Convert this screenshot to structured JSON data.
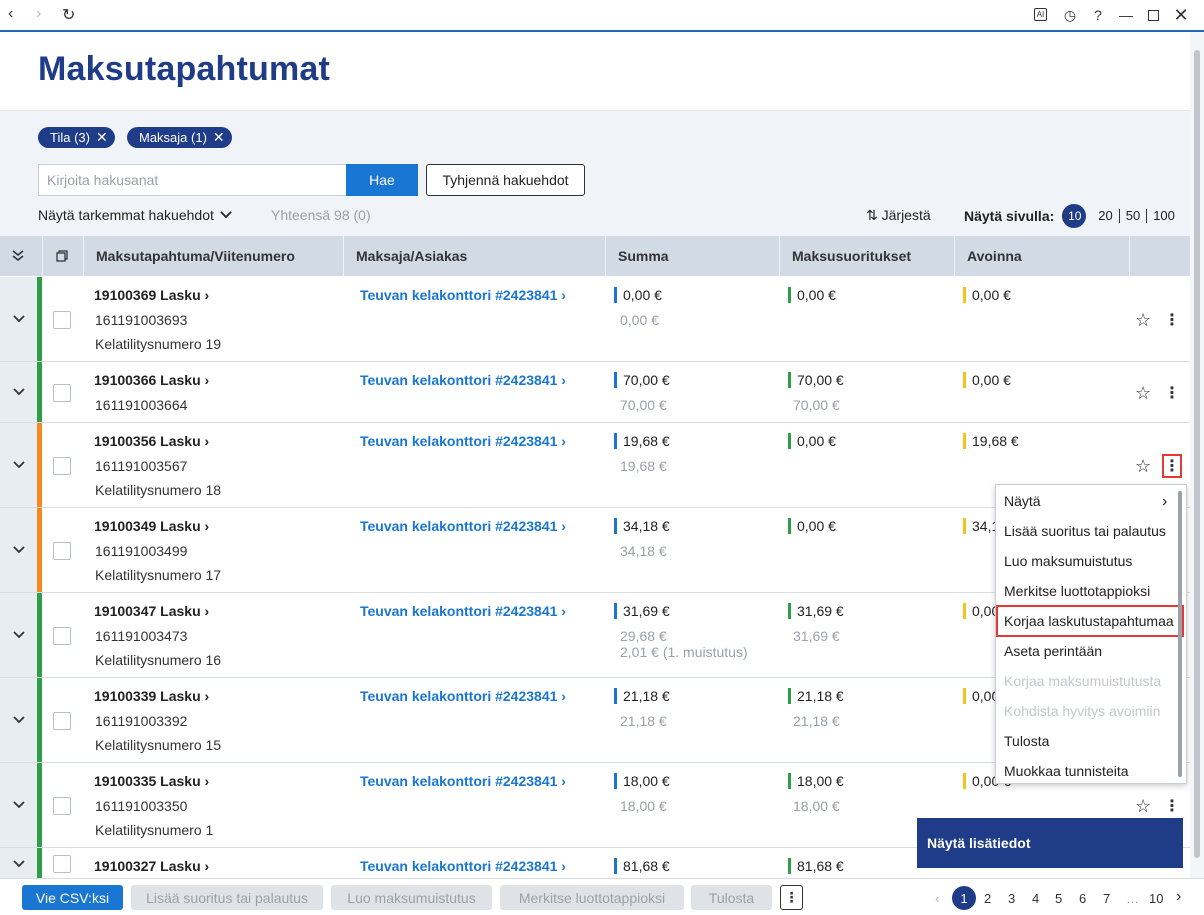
{
  "browser": {
    "back_icon": "chevron-left",
    "forward_icon": "chevron-right",
    "reload_icon": "reload",
    "ai_label": "AI",
    "help_label": "?"
  },
  "page": {
    "title": "Maksutapahtumat"
  },
  "filters": {
    "chips": [
      {
        "label": "Tila (3)"
      },
      {
        "label": "Maksaja (1)"
      }
    ],
    "search_placeholder": "Kirjoita hakusanat",
    "search_button": "Hae",
    "clear_button": "Tyhjennä hakuehdot",
    "advanced_label": "Näytä tarkemmat hakuehdot",
    "total_label": "Yhteensä 98 (0)",
    "sort_label": "Järjestä",
    "per_page_label": "Näytä sivulla:",
    "per_page_options": [
      "10",
      "20",
      "50",
      "100"
    ],
    "per_page_selected": "10"
  },
  "table": {
    "headers": {
      "transaction": "Maksutapahtuma/Viitenumero",
      "payer": "Maksaja/Asiakas",
      "amount": "Summa",
      "payments": "Maksusuoritukset",
      "open": "Avoinna"
    },
    "rows": [
      {
        "title": "19100369 Lasku",
        "ref": "161191003693",
        "note": "Kelatilitysnumero 19",
        "payer": "Teuvan kelakonttori #2423841",
        "amount": "0,00 €",
        "amount_sub": "0,00 €",
        "amount_sub2": "",
        "paid": "0,00 €",
        "paid_sub": "",
        "open": "0,00 €",
        "status_color": "#2e9e47"
      },
      {
        "title": "19100366 Lasku",
        "ref": "161191003664",
        "note": "",
        "payer": "Teuvan kelakonttori #2423841",
        "amount": "70,00 €",
        "amount_sub": "70,00 €",
        "amount_sub2": "",
        "paid": "70,00 €",
        "paid_sub": "70,00 €",
        "open": "0,00 €",
        "status_color": "#2e9e47"
      },
      {
        "title": "19100356 Lasku",
        "ref": "161191003567",
        "note": "Kelatilitysnumero 18",
        "payer": "Teuvan kelakonttori #2423841",
        "amount": "19,68 €",
        "amount_sub": "19,68 €",
        "amount_sub2": "",
        "paid": "0,00 €",
        "paid_sub": "",
        "open": "19,68 €",
        "status_color": "#f5891f"
      },
      {
        "title": "19100349 Lasku",
        "ref": "161191003499",
        "note": "Kelatilitysnumero 17",
        "payer": "Teuvan kelakonttori #2423841",
        "amount": "34,18 €",
        "amount_sub": "34,18 €",
        "amount_sub2": "",
        "paid": "0,00 €",
        "paid_sub": "",
        "open": "34,1",
        "status_color": "#f5891f"
      },
      {
        "title": "19100347 Lasku",
        "ref": "161191003473",
        "note": "Kelatilitysnumero 16",
        "payer": "Teuvan kelakonttori #2423841",
        "amount": "31,69 €",
        "amount_sub": "29,68 €",
        "amount_sub2": "2,01 € (1. muistutus)",
        "paid": "31,69 €",
        "paid_sub": "31,69 €",
        "open": "0,00",
        "status_color": "#2e9e47"
      },
      {
        "title": "19100339 Lasku",
        "ref": "161191003392",
        "note": "Kelatilitysnumero 15",
        "payer": "Teuvan kelakonttori #2423841",
        "amount": "21,18 €",
        "amount_sub": "21,18 €",
        "amount_sub2": "",
        "paid": "21,18 €",
        "paid_sub": "21,18 €",
        "open": "0,00",
        "status_color": "#2e9e47"
      },
      {
        "title": "19100335 Lasku",
        "ref": "161191003350",
        "note": "Kelatilitysnumero 1",
        "payer": "Teuvan kelakonttori #2423841",
        "amount": "18,00 €",
        "amount_sub": "18,00 €",
        "amount_sub2": "",
        "paid": "18,00 €",
        "paid_sub": "18,00 €",
        "open": "0,00 €",
        "status_color": "#2e9e47"
      },
      {
        "title": "19100327 Lasku",
        "ref": "",
        "note": "",
        "payer": "Teuvan kelakonttori #2423841",
        "amount": "81,68 €",
        "amount_sub": "",
        "amount_sub2": "",
        "paid": "81,68 €",
        "paid_sub": "",
        "open": "",
        "status_color": "#2e9e47"
      }
    ]
  },
  "context_menu": {
    "items": [
      {
        "label": "Näytä",
        "disabled": false
      },
      {
        "label": "Lisää suoritus tai palautus",
        "disabled": false
      },
      {
        "label": "Luo maksumuistutus",
        "disabled": false
      },
      {
        "label": "Merkitse luottotappioksi",
        "disabled": false
      },
      {
        "label": "Korjaa laskutustapahtumaa",
        "disabled": false
      },
      {
        "label": "Aseta perintään",
        "disabled": false
      },
      {
        "label": "Korjaa maksumuistutusta",
        "disabled": true
      },
      {
        "label": "Kohdista hyvitys avoimiin",
        "disabled": true
      },
      {
        "label": "Tulosta",
        "disabled": false
      },
      {
        "label": "Muokkaa tunnisteita",
        "disabled": false
      }
    ]
  },
  "more_info_label": "Näytä lisätiedot",
  "toolbar": {
    "csv": "Vie CSV:ksi",
    "add_payment": "Lisää suoritus tai palautus",
    "create_reminder": "Luo maksumuistutus",
    "mark_credit_loss": "Merkitse luottotappioksi",
    "print": "Tulosta"
  },
  "pagination": {
    "pages": [
      "1",
      "2",
      "3",
      "4",
      "5",
      "6",
      "7",
      "…",
      "10"
    ],
    "current": "1"
  },
  "colors": {
    "brand": "#1f3c88",
    "accent": "#1976d2",
    "ok": "#2e9e47",
    "warn": "#f5891f",
    "open": "#f2c318"
  }
}
